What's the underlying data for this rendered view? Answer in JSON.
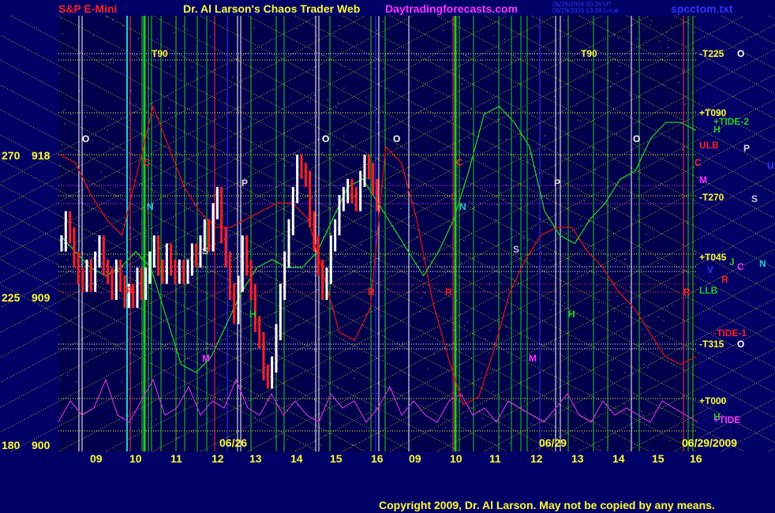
{
  "header": {
    "title_left": "S&P E-Mini",
    "title_mid": "Dr. Al Larson's Chaos Trader Web",
    "site": "Daytradingforecasts.com",
    "time_stamp_1": "06/26/2009 20:26 UT",
    "time_stamp_2": "06/29/2009 13:38 Local",
    "file": "spcctom.txt"
  },
  "footer": {
    "copyright": "Copyright 2009, Dr. Al Larson. May not be copied by any means."
  },
  "date_labels": [
    "06/26",
    "06/29",
    "06/29/2009"
  ],
  "colors": {
    "background": "#000066",
    "price_up": "#ffffff",
    "price_down": "#ff2020",
    "flux_green": "#22cc22",
    "flux_red": "#dd1111",
    "tide_magenta": "#cc33cc",
    "grid_yellow": "#cccc33",
    "axis_yellow": "#ffff33"
  },
  "chart_data": {
    "type": "line",
    "title": "S&P E-Mini",
    "y_ticks": [
      {
        "angle": "270",
        "price": "918"
      },
      {
        "angle": "225",
        "price": "909"
      },
      {
        "angle": "180",
        "price": "900"
      }
    ],
    "ylim": [
      900,
      918
    ],
    "x_ticks": [
      "09",
      "10",
      "11",
      "12",
      "13",
      "14",
      "15",
      "16",
      "09",
      "10",
      "11",
      "12",
      "13",
      "14",
      "15",
      "16"
    ],
    "right_labels": [
      {
        "text": "-T225",
        "color": "#ffff33"
      },
      {
        "text": "O",
        "color": "#ffffff"
      },
      {
        "text": "+T090",
        "color": "#ffff33"
      },
      {
        "text": "+TIDE-2",
        "color": "#22cc22"
      },
      {
        "text": "H",
        "color": "#22cc22"
      },
      {
        "text": "ULB",
        "color": "#ff2020"
      },
      {
        "text": "P",
        "color": "#dddddd"
      },
      {
        "text": "C",
        "color": "#ff2020"
      },
      {
        "text": "U",
        "color": "#3333ff"
      },
      {
        "text": "M",
        "color": "#ff33ff"
      },
      {
        "text": "-T270",
        "color": "#ffff33"
      },
      {
        "text": "S",
        "color": "#cccccc"
      },
      {
        "text": "+T045",
        "color": "#ffff33"
      },
      {
        "text": "J",
        "color": "#22cc22"
      },
      {
        "text": "C",
        "color": "#ff33ff"
      },
      {
        "text": "N",
        "color": "#22cccc"
      },
      {
        "text": "V",
        "color": "#3333ff"
      },
      {
        "text": "R",
        "color": "#ff2020"
      },
      {
        "text": "LLB",
        "color": "#22cc22"
      },
      {
        "text": "-TIDE-1",
        "color": "#ff2020"
      },
      {
        "text": "-T315",
        "color": "#ffff33"
      },
      {
        "text": "O",
        "color": "#ffffff"
      },
      {
        "text": "+T000",
        "color": "#ffff33"
      },
      {
        "text": "H",
        "color": "#22cc22"
      },
      {
        "text": "+TIDE",
        "color": "#ff33ff"
      }
    ],
    "markers": [
      {
        "text": "T90",
        "color": "#ffff33"
      },
      {
        "text": "T90",
        "color": "#ffff33"
      },
      {
        "text": "O",
        "color": "#ffffff"
      },
      {
        "text": "O",
        "color": "#ffffff"
      },
      {
        "text": "O",
        "color": "#ffffff"
      },
      {
        "text": "O",
        "color": "#ffffff"
      },
      {
        "text": "C",
        "color": "#ff2020"
      },
      {
        "text": "C",
        "color": "#ff2020"
      },
      {
        "text": "N",
        "color": "#22cccc"
      },
      {
        "text": "N",
        "color": "#22cccc"
      },
      {
        "text": "P",
        "color": "#dddddd"
      },
      {
        "text": "P",
        "color": "#dddddd"
      },
      {
        "text": "S",
        "color": "#cccccc"
      },
      {
        "text": "S",
        "color": "#cccccc"
      },
      {
        "text": "H",
        "color": "#22cc22"
      },
      {
        "text": "H",
        "color": "#22cc22"
      },
      {
        "text": "M",
        "color": "#ff33ff"
      },
      {
        "text": "M",
        "color": "#ff33ff"
      },
      {
        "text": "R",
        "color": "#ff2020"
      },
      {
        "text": "R",
        "color": "#ff2020"
      },
      {
        "text": "R",
        "color": "#ff2020"
      },
      {
        "text": "R",
        "color": "#ff2020"
      }
    ],
    "price_series": [
      912.5,
      914.0,
      913.0,
      911.5,
      910.5,
      910.0,
      911.0,
      910.0,
      911.5,
      912.5,
      911.0,
      910.5,
      909.5,
      911.0,
      910.0,
      909.0,
      909.5,
      909.0,
      910.5,
      909.5,
      910.5,
      911.5,
      912.5,
      911.0,
      910.5,
      912.0,
      911.0,
      910.5,
      911.0,
      910.5,
      911.0,
      912.0,
      911.5,
      912.5,
      913.5,
      912.5,
      914.5,
      915.5,
      913.0,
      911.5,
      909.5,
      908.0,
      910.0,
      912.5,
      911.0,
      909.5,
      907.5,
      906.5,
      904.5,
      904.0,
      905.0,
      907.0,
      909.5,
      911.5,
      913.5,
      915.5,
      917.5,
      917.0,
      916.5,
      914.0,
      912.5,
      911.0,
      909.5,
      910.5,
      912.5,
      913.5,
      915.0,
      915.5,
      916.0,
      915.5,
      915.0,
      916.5,
      917.5,
      917.0,
      916.0,
      915.0
    ],
    "green_flux": [
      913.0,
      912.0,
      911.0,
      910.5,
      911.0,
      912.0,
      911.0,
      908.0,
      905.0,
      904.5,
      905.5,
      907.5,
      909.5,
      911.0,
      911.5,
      911.0,
      911.0,
      912.0,
      914.0,
      916.0,
      916.5,
      915.0,
      913.5,
      912.0,
      910.5,
      912.0,
      914.0,
      917.0,
      920.5,
      921.0,
      920.0,
      918.5,
      914.5,
      913.0,
      912.5,
      914.0,
      915.0,
      916.5,
      917.0,
      919.0,
      920.0,
      920.0,
      919.5
    ],
    "red_flux": [
      918.0,
      917.5,
      915.5,
      914.0,
      913.0,
      917.0,
      921.0,
      918.5,
      916.0,
      914.5,
      913.5,
      913.5,
      914.0,
      914.5,
      915.0,
      915.0,
      914.0,
      910.5,
      907.0,
      906.5,
      908.5,
      918.5,
      917.5,
      914.0,
      909.0,
      905.5,
      902.5,
      903.0,
      906.0,
      909.5,
      911.5,
      913.0,
      913.5,
      913.5,
      912.0,
      911.0,
      909.5,
      908.5,
      907.0,
      905.5,
      905.0,
      905.5
    ],
    "tide": [
      3,
      6,
      4,
      5,
      9,
      4,
      3,
      6,
      9,
      4,
      5,
      8,
      4,
      6,
      5,
      9,
      5,
      4,
      7,
      4,
      6,
      4,
      3,
      7,
      5,
      6,
      3,
      5,
      8,
      4,
      6,
      4,
      3,
      6,
      7,
      4,
      5,
      3,
      6,
      5,
      4,
      3,
      5,
      7,
      4,
      3,
      6,
      4,
      5,
      4,
      3,
      6,
      5,
      4,
      3
    ]
  }
}
